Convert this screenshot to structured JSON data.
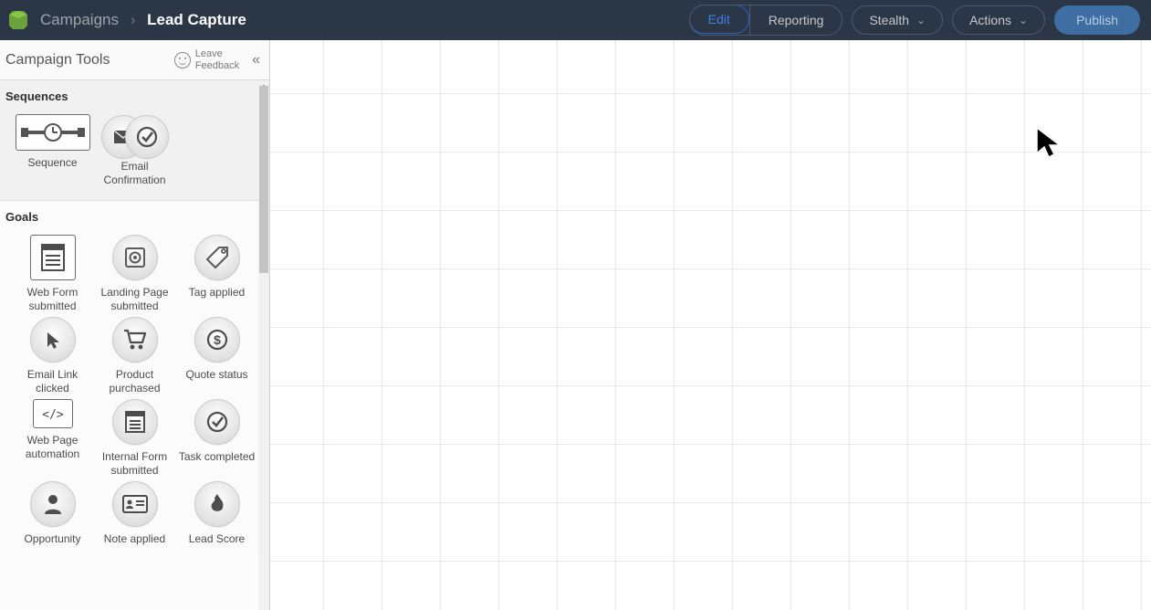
{
  "header": {
    "breadcrumb_root": "Campaigns",
    "breadcrumb_current": "Lead Capture",
    "tabs": {
      "edit": "Edit",
      "reporting": "Reporting"
    },
    "stealth_label": "Stealth",
    "actions_label": "Actions",
    "publish_label": "Publish"
  },
  "sidebar": {
    "title": "Campaign Tools",
    "feedback_line1": "Leave",
    "feedback_line2": "Feedback",
    "sections": {
      "sequences": {
        "title": "Sequences",
        "items": [
          {
            "label": "Sequence"
          },
          {
            "label": "Email Confirmation"
          }
        ]
      },
      "goals": {
        "title": "Goals",
        "items": [
          {
            "label": "Web Form submitted"
          },
          {
            "label": "Landing Page submitted"
          },
          {
            "label": "Tag applied"
          },
          {
            "label": "Email Link clicked"
          },
          {
            "label": "Product purchased"
          },
          {
            "label": "Quote status"
          },
          {
            "label": "Web Page automation"
          },
          {
            "label": "Internal Form submitted"
          },
          {
            "label": "Task completed"
          },
          {
            "label": "Opportunity"
          },
          {
            "label": "Note applied"
          },
          {
            "label": "Lead Score"
          }
        ]
      }
    }
  }
}
